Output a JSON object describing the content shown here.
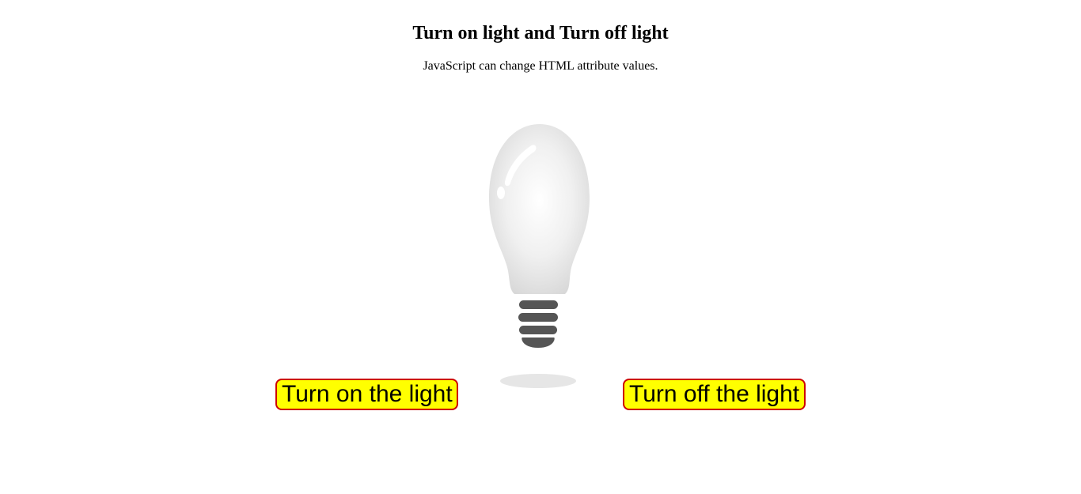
{
  "header": {
    "title": "Turn on light and Turn off light",
    "description": "JavaScript can change HTML attribute values."
  },
  "bulb": {
    "icon": "light-bulb-off",
    "state": "off",
    "glass_color": "#e0e0e0",
    "base_color": "#555555"
  },
  "controls": {
    "on_label": "Turn on the light",
    "off_label": "Turn off the light",
    "button_bg": "#ffff00",
    "button_border": "#cc0000"
  }
}
